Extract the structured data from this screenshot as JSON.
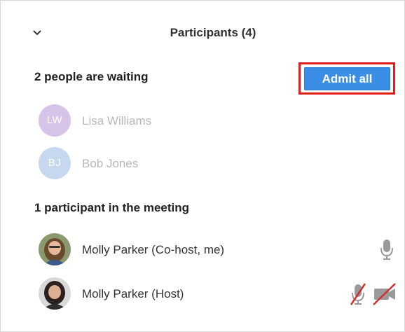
{
  "header": {
    "title": "Participants (4)"
  },
  "waiting": {
    "heading": "2 people are waiting",
    "admit_all_label": "Admit all",
    "items": [
      {
        "initials": "LW",
        "name": "Lisa Williams",
        "avatar_color": "#d7c3e8"
      },
      {
        "initials": "BJ",
        "name": "Bob Jones",
        "avatar_color": "#c5d8ef"
      }
    ]
  },
  "meeting": {
    "heading": "1 participant in the meeting",
    "items": [
      {
        "name": "Molly Parker (Co-host, me)",
        "mic": "mic-icon"
      },
      {
        "name": "Molly Parker (Host)",
        "mic": "mic-muted-icon",
        "video": "video-off-icon"
      }
    ]
  },
  "colors": {
    "accent": "#3a8ee6",
    "highlight": "#e11d1d",
    "muted": "#d32f2f"
  }
}
